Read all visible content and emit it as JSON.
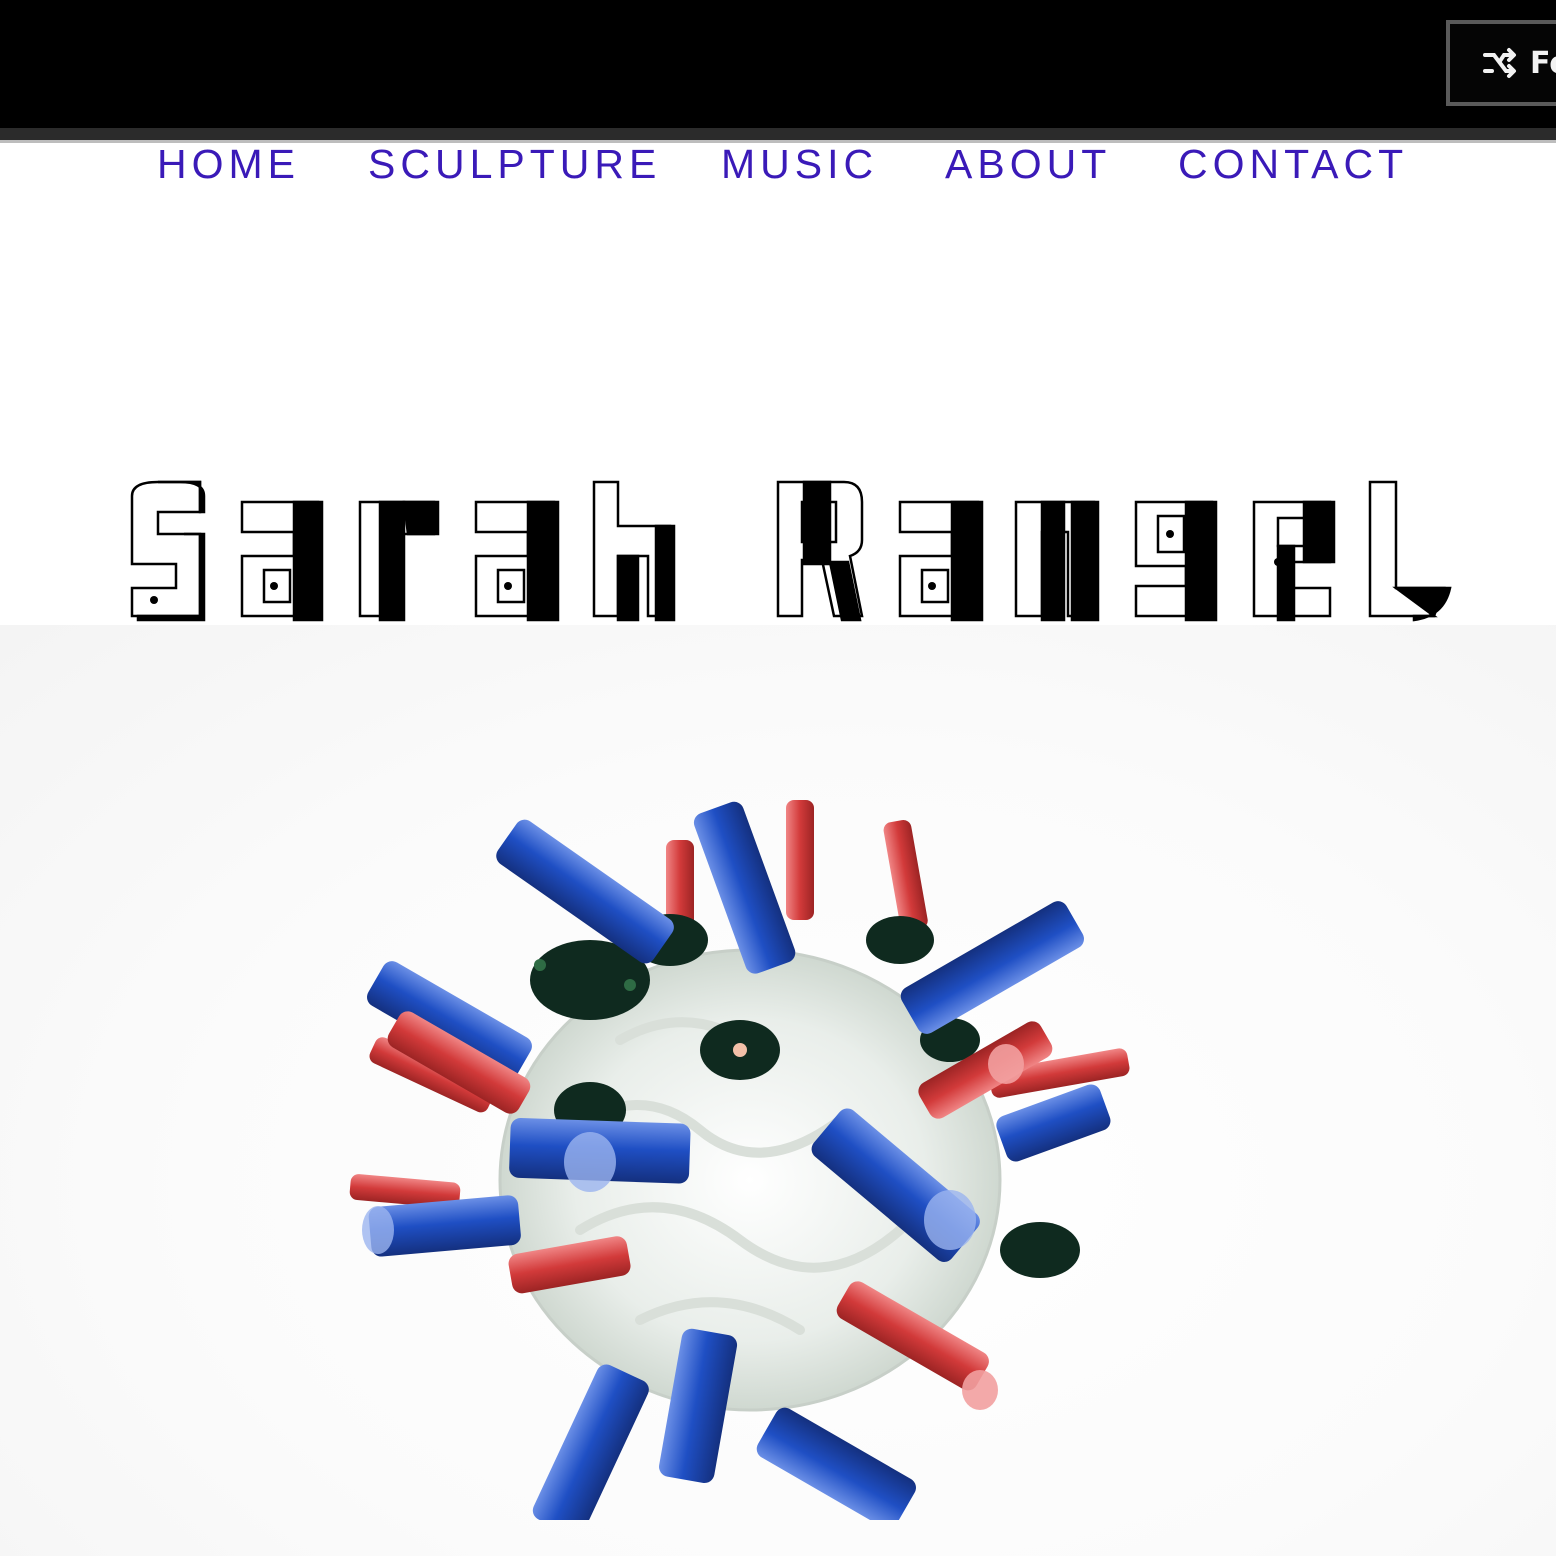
{
  "header": {
    "follow_label": "Follow",
    "follow_icon": "share-arrows-icon"
  },
  "nav": {
    "items": [
      {
        "label": "HOME"
      },
      {
        "label": "SCULPTURE"
      },
      {
        "label": "MUSIC"
      },
      {
        "label": "ABOUT"
      },
      {
        "label": "CONTACT"
      }
    ],
    "color": "#3a1ab8"
  },
  "hero": {
    "logo_text": "Sarah Rangel",
    "image_alt": "ceramic sculpture with blue and red glazed spikes"
  },
  "colors": {
    "topbar": "#000000",
    "sculpture_blue": "#1f4fc4",
    "sculpture_red": "#d23a3a"
  }
}
